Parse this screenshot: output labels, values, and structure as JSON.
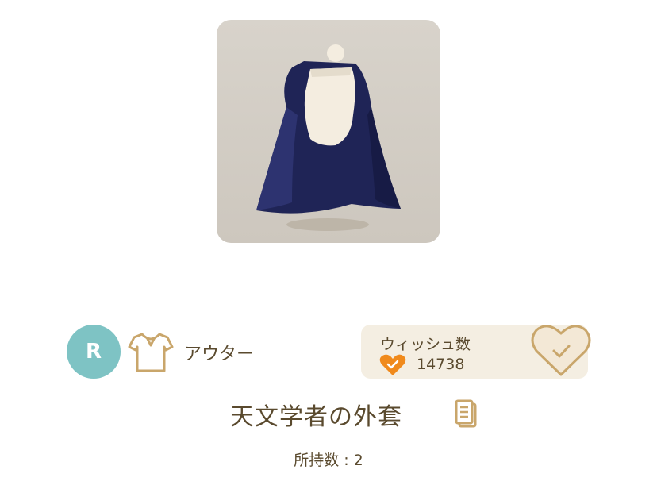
{
  "item": {
    "name": "天文学者の外套",
    "category": "アウター",
    "rarity": "R",
    "category_icon": "shirt-icon",
    "detail_icon": "document-icon"
  },
  "wish": {
    "title": "ウィッシュ数",
    "count": "14738",
    "icon": "heart-icon",
    "button_icon": "heart-check-icon"
  },
  "owned": {
    "label": "所持数 : 2"
  },
  "colors": {
    "rarity_badge": "#7ec3c4",
    "text": "#5a4a2e",
    "accent_orange": "#f08a1c",
    "gold": "#c9a66b",
    "panel_bg": "#f4eee2"
  }
}
